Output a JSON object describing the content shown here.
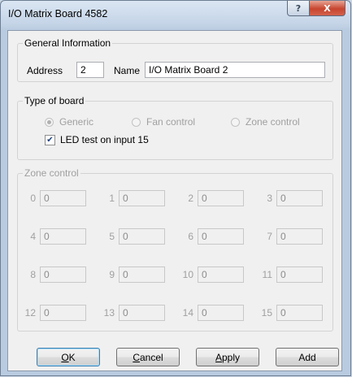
{
  "window": {
    "title": "I/O Matrix Board 4582"
  },
  "caption_buttons": {
    "help": "?",
    "close": "X"
  },
  "general": {
    "legend": "General Information",
    "address_label": "Address",
    "address_value": "2",
    "name_label": "Name",
    "name_value": "I/O Matrix Board 2"
  },
  "board_type": {
    "legend": "Type of board",
    "options": [
      "Generic",
      "Fan control",
      "Zone control"
    ],
    "selected": "Generic",
    "led_test_label": "LED test on input 15",
    "led_test_checked": true
  },
  "zone_control": {
    "legend": "Zone control",
    "zones": [
      {
        "label": "0",
        "value": "0"
      },
      {
        "label": "1",
        "value": "0"
      },
      {
        "label": "2",
        "value": "0"
      },
      {
        "label": "3",
        "value": "0"
      },
      {
        "label": "4",
        "value": "0"
      },
      {
        "label": "5",
        "value": "0"
      },
      {
        "label": "6",
        "value": "0"
      },
      {
        "label": "7",
        "value": "0"
      },
      {
        "label": "8",
        "value": "0"
      },
      {
        "label": "9",
        "value": "0"
      },
      {
        "label": "10",
        "value": "0"
      },
      {
        "label": "11",
        "value": "0"
      },
      {
        "label": "12",
        "value": "0"
      },
      {
        "label": "13",
        "value": "0"
      },
      {
        "label": "14",
        "value": "0"
      },
      {
        "label": "15",
        "value": "0"
      }
    ]
  },
  "buttons": {
    "ok": {
      "label": "OK",
      "mnemonic": "O",
      "rest": "K"
    },
    "cancel": {
      "label": "Cancel",
      "mnemonic": "C",
      "rest": "ancel"
    },
    "apply": {
      "label": "Apply",
      "mnemonic": "A",
      "rest": "pply"
    },
    "add": {
      "label": "Add"
    }
  }
}
